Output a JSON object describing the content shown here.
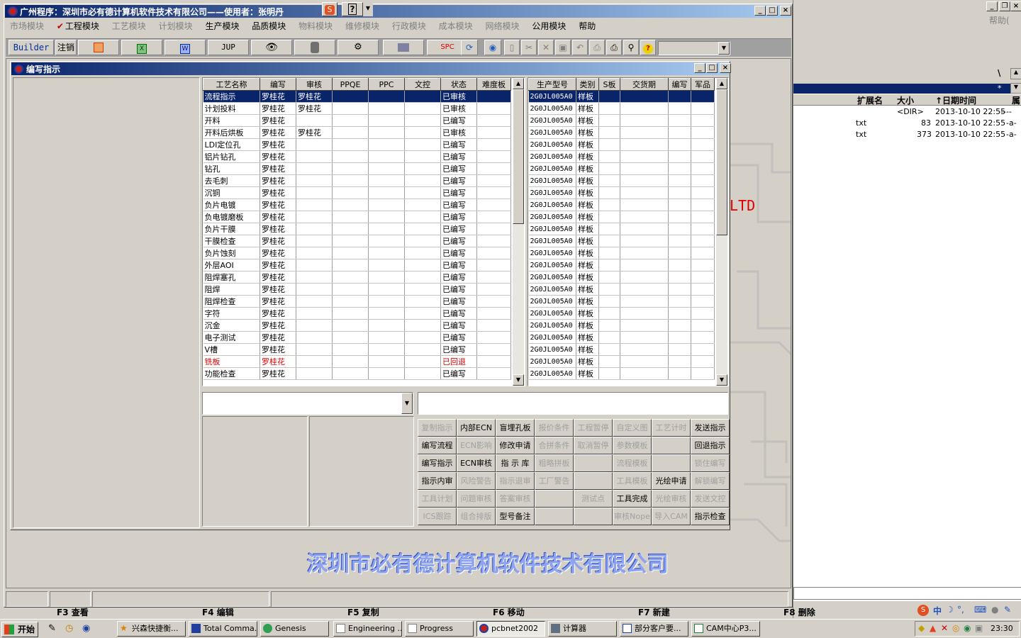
{
  "main_window": {
    "title": "广州程序：深圳市必有德计算机软件技术有限公司——使用者：张明丹"
  },
  "title_icon_buttons": [
    "S",
    "?"
  ],
  "menu": [
    {
      "label": "市场模块",
      "enabled": false
    },
    {
      "label": "工程模块",
      "enabled": true,
      "checked": true
    },
    {
      "label": "工艺模块",
      "enabled": false
    },
    {
      "label": "计划模块",
      "enabled": false
    },
    {
      "label": "生产模块",
      "enabled": true
    },
    {
      "label": "品质模块",
      "enabled": true
    },
    {
      "label": "物料模块",
      "enabled": false
    },
    {
      "label": "维修模块",
      "enabled": false
    },
    {
      "label": "行政模块",
      "enabled": false
    },
    {
      "label": "成本模块",
      "enabled": false
    },
    {
      "label": "网络模块",
      "enabled": false
    },
    {
      "label": "公用模块",
      "enabled": true
    },
    {
      "label": "帮助",
      "enabled": true
    }
  ],
  "toolbar": {
    "builder": "Builder",
    "logout": "注销",
    "jup": "JUP",
    "spc": "SPC"
  },
  "child_window": {
    "title": "编写指示"
  },
  "process_table": {
    "headers": [
      "工艺名称",
      "编写",
      "审核",
      "PPQE",
      "PPC",
      "文控",
      "状态",
      "难度板"
    ],
    "rows": [
      {
        "name": "流程指示",
        "writer": "罗桂花",
        "reviewer": "罗桂花",
        "status": "已审核",
        "selected": true
      },
      {
        "name": "计划投料",
        "writer": "罗桂花",
        "reviewer": "罗桂花",
        "status": "已审核"
      },
      {
        "name": "开料",
        "writer": "罗桂花",
        "reviewer": "",
        "status": "已编写"
      },
      {
        "name": "开料后烘板",
        "writer": "罗桂花",
        "reviewer": "罗桂花",
        "status": "已审核"
      },
      {
        "name": "LDI定位孔",
        "writer": "罗桂花",
        "reviewer": "",
        "status": "已编写"
      },
      {
        "name": "铝片钻孔",
        "writer": "罗桂花",
        "reviewer": "",
        "status": "已编写"
      },
      {
        "name": "钻孔",
        "writer": "罗桂花",
        "reviewer": "",
        "status": "已编写"
      },
      {
        "name": "去毛刺",
        "writer": "罗桂花",
        "reviewer": "",
        "status": "已编写"
      },
      {
        "name": "沉铜",
        "writer": "罗桂花",
        "reviewer": "",
        "status": "已编写"
      },
      {
        "name": "负片电镀",
        "writer": "罗桂花",
        "reviewer": "",
        "status": "已编写"
      },
      {
        "name": "负电镀磨板",
        "writer": "罗桂花",
        "reviewer": "",
        "status": "已编写"
      },
      {
        "name": "负片干膜",
        "writer": "罗桂花",
        "reviewer": "",
        "status": "已编写"
      },
      {
        "name": "干膜检查",
        "writer": "罗桂花",
        "reviewer": "",
        "status": "已编写"
      },
      {
        "name": "负片蚀刻",
        "writer": "罗桂花",
        "reviewer": "",
        "status": "已编写"
      },
      {
        "name": "外层AOI",
        "writer": "罗桂花",
        "reviewer": "",
        "status": "已编写"
      },
      {
        "name": "阻焊塞孔",
        "writer": "罗桂花",
        "reviewer": "",
        "status": "已编写"
      },
      {
        "name": "阻焊",
        "writer": "罗桂花",
        "reviewer": "",
        "status": "已编写"
      },
      {
        "name": "阻焊检查",
        "writer": "罗桂花",
        "reviewer": "",
        "status": "已编写"
      },
      {
        "name": "字符",
        "writer": "罗桂花",
        "reviewer": "",
        "status": "已编写"
      },
      {
        "name": "沉金",
        "writer": "罗桂花",
        "reviewer": "",
        "status": "已编写"
      },
      {
        "name": "电子测试",
        "writer": "罗桂花",
        "reviewer": "",
        "status": "已编写"
      },
      {
        "name": "V槽",
        "writer": "罗桂花",
        "reviewer": "",
        "status": "已编写"
      },
      {
        "name": "铣板",
        "writer": "罗桂花",
        "reviewer": "",
        "status": "已回退",
        "red": true
      },
      {
        "name": "功能检查",
        "writer": "罗桂花",
        "reviewer": "",
        "status": "已编写"
      }
    ]
  },
  "product_table": {
    "headers": [
      "生产型号",
      "类别",
      "S板",
      "交货期",
      "编写",
      "军品"
    ],
    "row_count": 24,
    "model": "2G0JL005A0",
    "category": "样板"
  },
  "buttons": [
    [
      {
        "l": "复制指示",
        "e": false
      },
      {
        "l": "内部ECN",
        "e": true
      },
      {
        "l": "盲埋孔板",
        "e": true
      },
      {
        "l": "报价条件",
        "e": false
      },
      {
        "l": "工程暂停",
        "e": false
      },
      {
        "l": "自定义图",
        "e": false
      },
      {
        "l": "工艺计时",
        "e": false
      },
      {
        "l": "发送指示",
        "e": true
      }
    ],
    [
      {
        "l": "编写流程",
        "e": true
      },
      {
        "l": "ECN影响",
        "e": false
      },
      {
        "l": "修改申请",
        "e": true
      },
      {
        "l": "合拼条件",
        "e": false
      },
      {
        "l": "取消暂停",
        "e": false
      },
      {
        "l": "参数模板",
        "e": false
      },
      {
        "l": "",
        "e": false
      },
      {
        "l": "回退指示",
        "e": true
      }
    ],
    [
      {
        "l": "编写指示",
        "e": true
      },
      {
        "l": "ECN审核",
        "e": true
      },
      {
        "l": "指 示 库",
        "e": true
      },
      {
        "l": "粗略拼板",
        "e": false
      },
      {
        "l": "",
        "e": false
      },
      {
        "l": "流程模板",
        "e": false
      },
      {
        "l": "",
        "e": false
      },
      {
        "l": "锁住编写",
        "e": false
      }
    ],
    [
      {
        "l": "指示内审",
        "e": true
      },
      {
        "l": "风险警告",
        "e": false
      },
      {
        "l": "指示退审",
        "e": false
      },
      {
        "l": "工厂警告",
        "e": false
      },
      {
        "l": "",
        "e": false
      },
      {
        "l": "工具模板",
        "e": false
      },
      {
        "l": "光绘申请",
        "e": true
      },
      {
        "l": "解锁编写",
        "e": false
      }
    ],
    [
      {
        "l": "工具计划",
        "e": false
      },
      {
        "l": "问题审核",
        "e": false
      },
      {
        "l": "答案审核",
        "e": false
      },
      {
        "l": "",
        "e": false
      },
      {
        "l": "测试点",
        "e": false
      },
      {
        "l": "工具完成",
        "e": true
      },
      {
        "l": "光绘审核",
        "e": false
      },
      {
        "l": "发送文控",
        "e": false
      }
    ],
    [
      {
        "l": "ICS跟踪",
        "e": false
      },
      {
        "l": "组合排版",
        "e": false
      },
      {
        "l": "型号备注",
        "e": true
      },
      {
        "l": "",
        "e": false
      },
      {
        "l": "",
        "e": false
      },
      {
        "l": "审核Nope",
        "e": false
      },
      {
        "l": "导入CAM",
        "e": false
      },
      {
        "l": "指示检查",
        "e": true
      }
    ]
  ],
  "watermark": "深圳市必有德计算机软件技术有限公司",
  "ltd": "LTD",
  "right_panel": {
    "help": "帮助(",
    "path_text": "\\",
    "star": "*",
    "headers": [
      "扩展名",
      "大小",
      "↑日期时间",
      "属"
    ],
    "rows": [
      {
        "ext": "",
        "size": "<DIR>",
        "date": "2013-10-10 22:55",
        "attr": "----"
      },
      {
        "ext": "txt",
        "size": "83",
        "date": "2013-10-10 22:55",
        "attr": "-a-"
      },
      {
        "ext": "txt",
        "size": "373",
        "date": "2013-10-10 22:55",
        "attr": "-a-"
      }
    ]
  },
  "fkeys": [
    "F3 查看",
    "F4 编辑",
    "F5 复制",
    "F6 移动",
    "F7 新建",
    "F8 删除"
  ],
  "taskbar": {
    "start": "开始",
    "tasks": [
      "兴森快捷衡...",
      "Total Comma...",
      "Genesis",
      "Engineering ...",
      "Progress",
      "pcbnet2002",
      "计算器",
      "部分客户要...",
      "CAM中心P3..."
    ],
    "ime": "中",
    "clock": "23:30"
  }
}
